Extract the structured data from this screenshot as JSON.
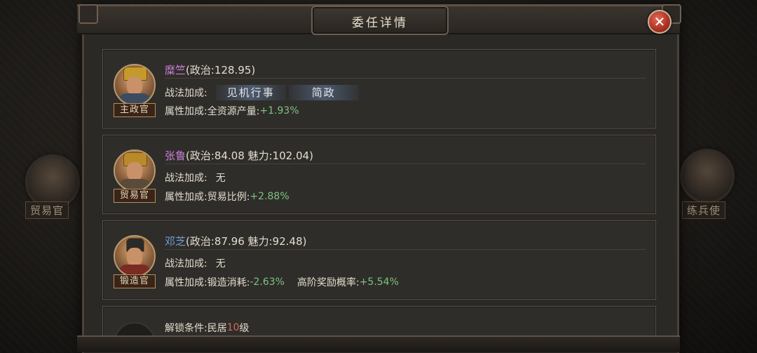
{
  "dialog": {
    "title": "委任详情"
  },
  "side": {
    "left_label": "贸易官",
    "right_label": "练兵使"
  },
  "officers": [
    {
      "name": "糜竺",
      "stats": "(政治:128.95)",
      "role": "主政官",
      "skills_label": "战法加成:",
      "skills": [
        "见机行事",
        "简政"
      ],
      "attr_label": "属性加成:",
      "attr_text": "全资源产量:",
      "attr_value": "+1.93%"
    },
    {
      "name": "张鲁",
      "stats": "(政治:84.08 魅力:102.04)",
      "role": "贸易官",
      "skills_label": "战法加成:",
      "skills_none": "无",
      "attr_label": "属性加成:",
      "attr_text": "贸易比例:",
      "attr_value": "+2.88%"
    },
    {
      "name": "邓芝",
      "stats": "(政治:87.96 魅力:92.48)",
      "role": "锻造官",
      "skills_label": "战法加成:",
      "skills_none": "无",
      "attr_label": "属性加成:",
      "attr_text": "锻造消耗:",
      "attr_value": "-2.63%",
      "attr2_text": "高阶奖励概率:",
      "attr2_value": "+5.54%"
    }
  ],
  "locked": {
    "label": "解锁条件:民居",
    "level": "10",
    "suffix": "级"
  },
  "colors": {
    "name_purple": "#c77ed4",
    "name_blue": "#6f9ed8",
    "bonus_green": "#7cc37e",
    "close_red": "#b13424"
  }
}
